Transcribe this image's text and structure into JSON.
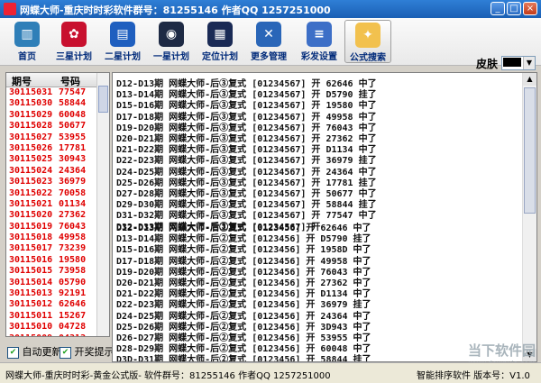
{
  "window": {
    "title": "网蝶大师-重庆时时彩软件群号：81255146 作者QQ 1257251000",
    "min": "_",
    "max": "□",
    "close": "×"
  },
  "toolbar": [
    {
      "label": "首页",
      "icon": "monitor-icon",
      "color": "#2f7fb8",
      "glyph": "▥"
    },
    {
      "label": "三星计划",
      "icon": "bow-icon",
      "color": "#c8102e",
      "glyph": "✿"
    },
    {
      "label": "二星计划",
      "icon": "window-icon",
      "color": "#1f5fbf",
      "glyph": "▤"
    },
    {
      "label": "一星计划",
      "icon": "record-icon",
      "color": "#1e2a44",
      "glyph": "◉"
    },
    {
      "label": "定位计划",
      "icon": "grid-icon",
      "color": "#1a2a55",
      "glyph": "▦"
    },
    {
      "label": "更多管理",
      "icon": "tools-icon",
      "color": "#2a66b8",
      "glyph": "✕"
    },
    {
      "label": "彩发设置",
      "icon": "database-icon",
      "color": "#3d6fc7",
      "glyph": "≡"
    },
    {
      "label": "公式搜索",
      "icon": "gift-icon",
      "color": "#f2c14e",
      "glyph": "✦"
    }
  ],
  "skin": {
    "label": "皮肤",
    "value_color": "#000000"
  },
  "draw_table": {
    "headers": [
      "期号",
      "号码"
    ],
    "rows": [
      [
        "30115031",
        "77547"
      ],
      [
        "30115030",
        "58844"
      ],
      [
        "30115029",
        "60048"
      ],
      [
        "30115028",
        "50677"
      ],
      [
        "30115027",
        "53955"
      ],
      [
        "30115026",
        "17781"
      ],
      [
        "30115025",
        "30943"
      ],
      [
        "30115024",
        "24364"
      ],
      [
        "30115023",
        "36979"
      ],
      [
        "30115022",
        "70058"
      ],
      [
        "30115021",
        "01134"
      ],
      [
        "30115020",
        "27362"
      ],
      [
        "30115019",
        "76043"
      ],
      [
        "30115018",
        "49958"
      ],
      [
        "30115017",
        "73239"
      ],
      [
        "30115016",
        "19580"
      ],
      [
        "30115015",
        "73958"
      ],
      [
        "30115014",
        "05790"
      ],
      [
        "30115013",
        "92191"
      ],
      [
        "30115012",
        "62646"
      ],
      [
        "30115011",
        "15267"
      ],
      [
        "30115010",
        "04728"
      ],
      [
        "30115009",
        "04312"
      ],
      [
        "30115008",
        "16067"
      ],
      [
        "30115007",
        "80750"
      ],
      [
        "30115006",
        "98378"
      ]
    ]
  },
  "options": {
    "auto_update": "自动更新",
    "draw_alert": "开奖提示"
  },
  "plans": {
    "group1": [
      "D12-D13期 网蝶大师-后③复式 [01234567] 开 62646 中了",
      "D13-D14期 网蝶大师-后③复式 [01234567] 开 D5790 挂了",
      "D15-D16期 网蝶大师-后③复式 [01234567] 开 19580 中了",
      "D17-D18期 网蝶大师-后③复式 [01234567] 开 49958 中了",
      "D19-D20期 网蝶大师-后③复式 [01234567] 开 76043 中了",
      "D20-D21期 网蝶大师-后③复式 [01234567] 开 27362 中了",
      "D21-D22期 网蝶大师-后③复式 [01234567] 开 D1134 中了",
      "D22-D23期 网蝶大师-后③复式 [01234567] 开 36979 挂了",
      "D24-D25期 网蝶大师-后③复式 [01234567] 开 24364 中了",
      "D25-D26期 网蝶大师-后③复式 [01234567] 开 17781 挂了",
      "D27-D28期 网蝶大师-后③复式 [01234567] 开 50677 中了",
      "D29-D30期 网蝶大师-后③复式 [01234567] 开 58844 挂了",
      "D31-D32期 网蝶大师-后③复式 [01234567] 开 77547 中了",
      "D32-D33期 网蝶大师-后③复式 [01234567] 开"
    ],
    "group2": [
      "D12-D13期 网蝶大师-后②复式 [0123456] 开 62646 中了",
      "D13-D14期 网蝶大师-后②复式 [0123456] 开 D5790 挂了",
      "D15-D16期 网蝶大师-后②复式 [0123456] 开 1958D 中了",
      "D17-D18期 网蝶大师-后②复式 [0123456] 开 49958 中了",
      "D19-D20期 网蝶大师-后②复式 [0123456] 开 76043 中了",
      "D20-D21期 网蝶大师-后②复式 [0123456] 开 27362 中了",
      "D21-D22期 网蝶大师-后②复式 [0123456] 开 D1134 中了",
      "D22-D23期 网蝶大师-后②复式 [0123456] 开 36979 挂了",
      "D24-D25期 网蝶大师-后②复式 [0123456] 开 24364 中了",
      "D25-D26期 网蝶大师-后②复式 [0123456] 开 3D943 中了",
      "D26-D27期 网蝶大师-后②复式 [0123456] 开 53955 中了",
      "D28-D29期 网蝶大师-后②复式 [0123456] 开 60048 中了",
      "D3D-D31期 网蝶大师-后②复式 [0123456] 开 58844 挂了",
      "D31-D32期 网蝶大师-后②复式 [0123456] 开"
    ]
  },
  "status": {
    "left": "网蝶大师-重庆时时彩-黄金公式版- 软件群号：81255146 作者QQ 1257251000",
    "right": "智能排序软件 版本号：V1.0"
  },
  "watermark": {
    "main": "当下软件园",
    "sub": "www.downxia.com"
  }
}
